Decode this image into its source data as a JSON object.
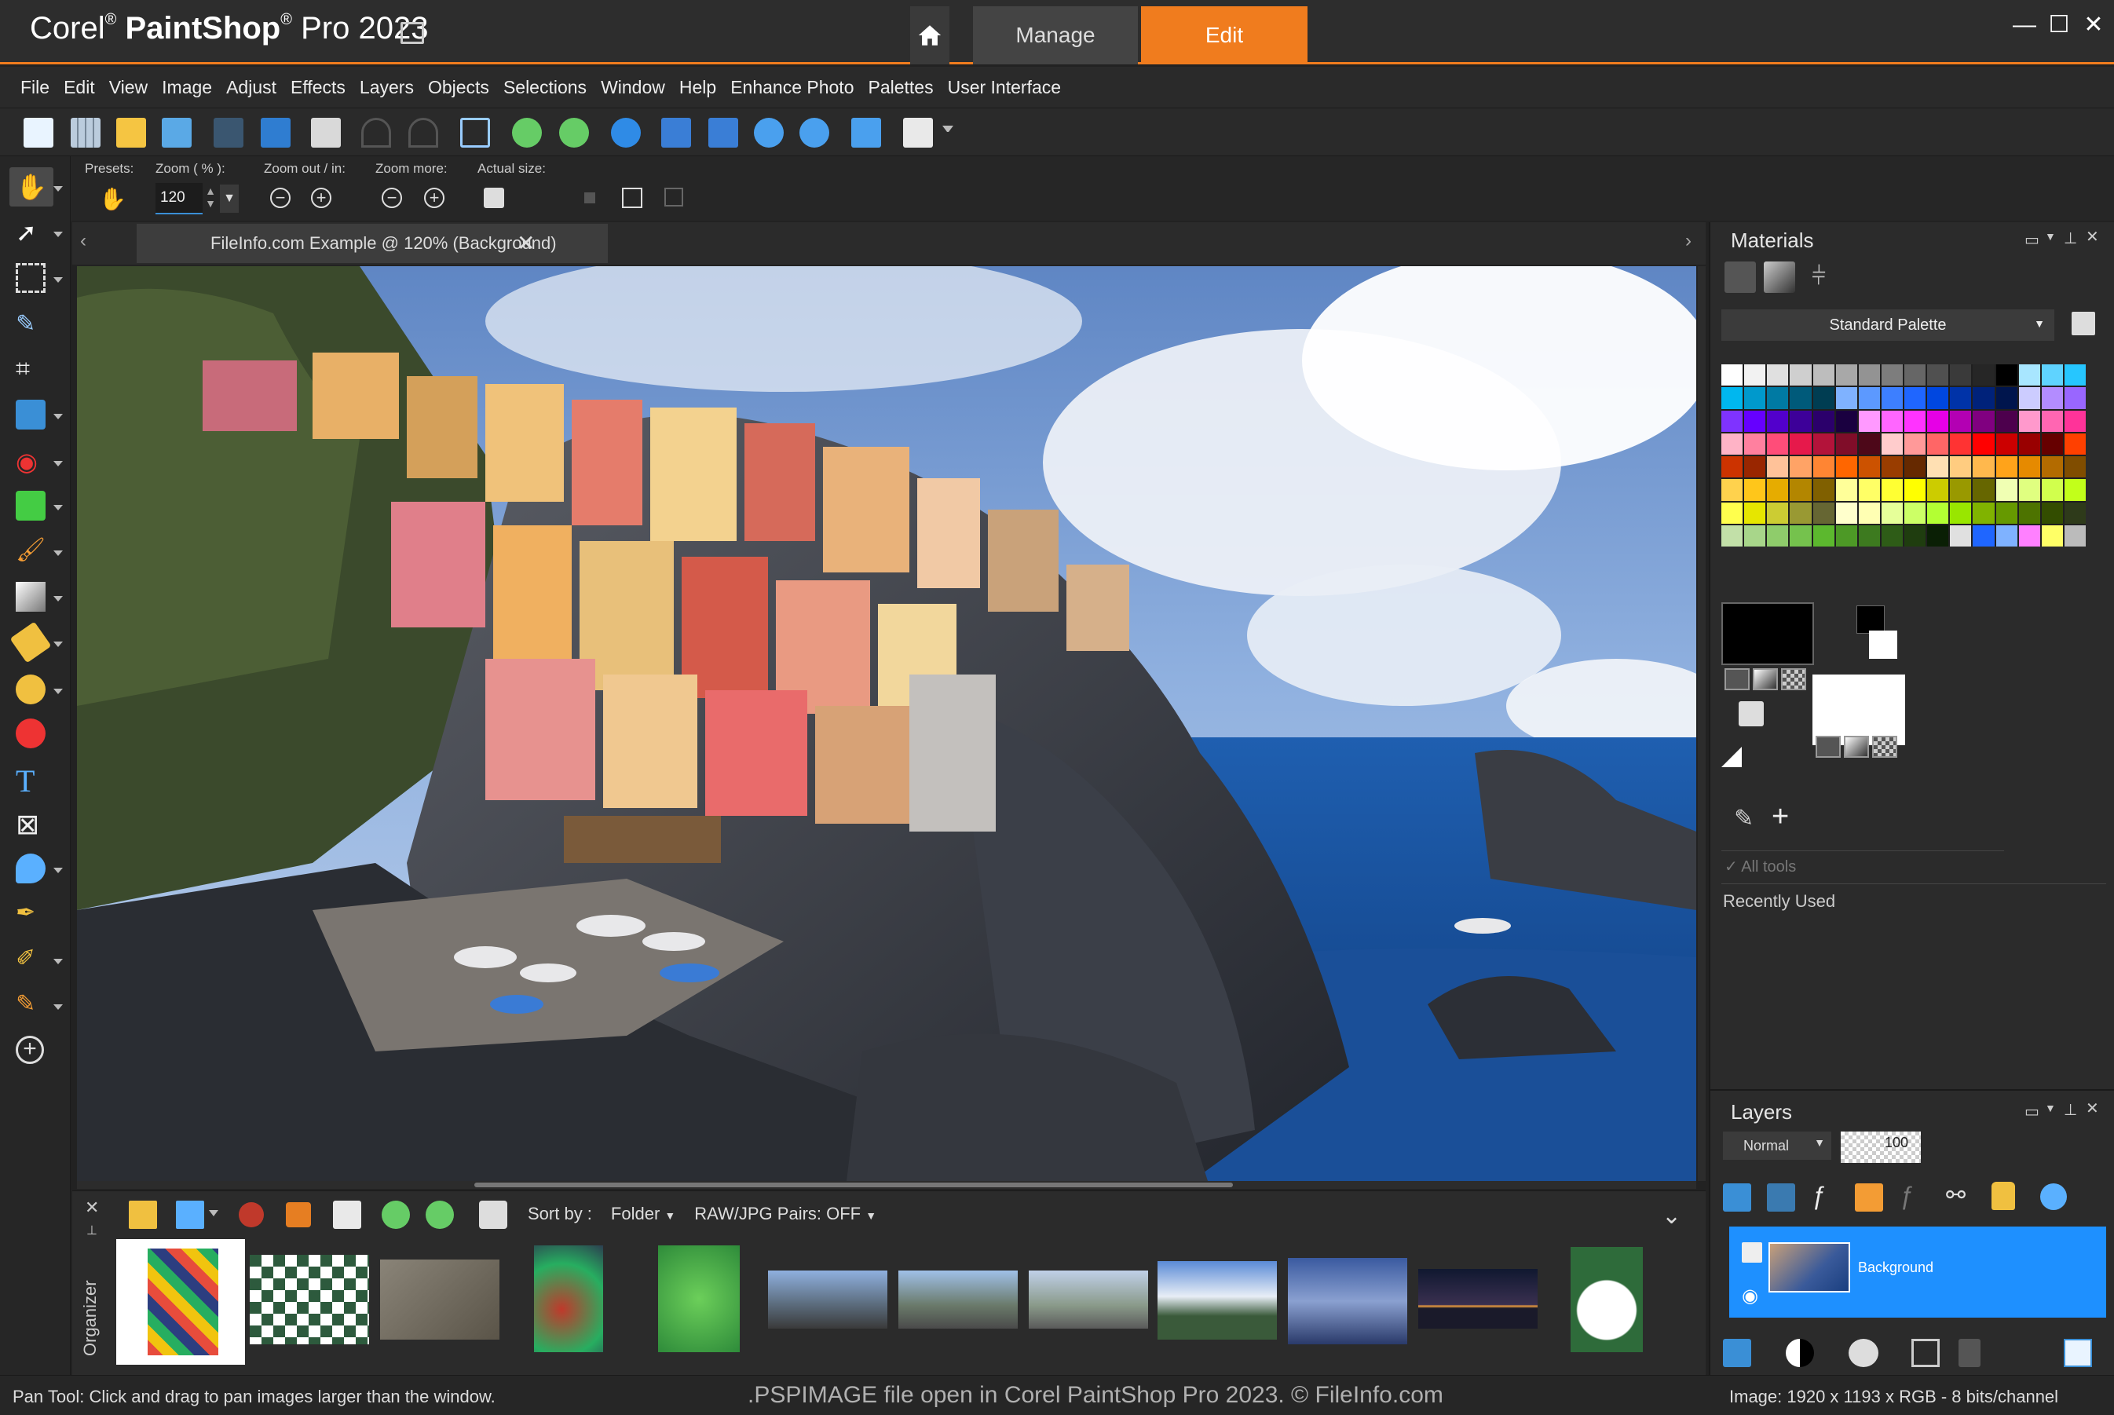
{
  "app": {
    "brand": "Corel",
    "name": "PaintShop",
    "suffix": "Pro 2023"
  },
  "workspace_tabs": {
    "manage": "Manage",
    "edit": "Edit"
  },
  "window_controls": {
    "minimize": "—",
    "maximize": "☐",
    "close": "✕"
  },
  "menu": [
    {
      "label": "File"
    },
    {
      "label": "Edit"
    },
    {
      "label": "View"
    },
    {
      "label": "Image"
    },
    {
      "label": "Adjust"
    },
    {
      "label": "Effects"
    },
    {
      "label": "Layers"
    },
    {
      "label": "Objects"
    },
    {
      "label": "Selections"
    },
    {
      "label": "Window"
    },
    {
      "label": "Help"
    },
    {
      "label": "Enhance Photo"
    },
    {
      "label": "Palettes"
    },
    {
      "label": "User Interface"
    }
  ],
  "options_bar": {
    "presets_label": "Presets:",
    "zoom_label": "Zoom ( % ):",
    "zoom_value": "120",
    "zoom_out_in_label": "Zoom out / in:",
    "zoom_more_label": "Zoom more:",
    "actual_size_label": "Actual size:"
  },
  "document": {
    "tab_label": "FileInfo.com Example @ 120% (Background)"
  },
  "materials": {
    "title": "Materials",
    "palette_name": "Standard Palette",
    "all_tools_label": "All tools",
    "recently_used_label": "Recently Used"
  },
  "layers": {
    "title": "Layers",
    "blend_mode": "Normal",
    "opacity": "100",
    "layer_name": "Background"
  },
  "organizer": {
    "side_label": "Organizer",
    "sort_by_label": "Sort by :",
    "sort_by_value": "Folder",
    "raw_jpg_label": "RAW/JPG Pairs: OFF"
  },
  "status": {
    "tool_hint": "Pan Tool: Click and drag to pan images larger than the window.",
    "watermark": ".PSPIMAGE file open in Corel PaintShop Pro 2023. © FileInfo.com",
    "image_info": "Image:  1920 x 1193 x RGB - 8 bits/channel"
  },
  "colors": {
    "accent": "#f07c1e",
    "selection": "#1e90ff",
    "palette": [
      "#ffffff",
      "#f2f2f2",
      "#e0e0e0",
      "#cfcfcf",
      "#bdbdbd",
      "#a8a8a8",
      "#939393",
      "#7d7d7d",
      "#666666",
      "#505050",
      "#3a3a3a",
      "#262626",
      "#000000",
      "#a8e6ff",
      "#5fd3ff",
      "#26c6ff",
      "#00b7ef",
      "#0099cc",
      "#007aa3",
      "#005a7a",
      "#003d52",
      "#7fb2ff",
      "#5c99ff",
      "#3d7fff",
      "#1f66ff",
      "#0047e0",
      "#0033a8",
      "#00227a",
      "#00154d",
      "#ccccff",
      "#b38cff",
      "#9966ff",
      "#7f33ff",
      "#6600ff",
      "#5200cc",
      "#3d0099",
      "#2b006b",
      "#1a0040",
      "#ff99ff",
      "#ff66ff",
      "#ff33ff",
      "#e600e6",
      "#b300b3",
      "#800080",
      "#4d004d",
      "#ff99cc",
      "#ff66b2",
      "#ff3399",
      "#ffb3c6",
      "#ff809f",
      "#ff4d79",
      "#e6194b",
      "#b3133a",
      "#800d29",
      "#4d0819",
      "#ffcccc",
      "#ff9999",
      "#ff6666",
      "#ff3333",
      "#ff0000",
      "#cc0000",
      "#990000",
      "#660000",
      "#ff4000",
      "#cc3300",
      "#992600",
      "#ffc299",
      "#ffa366",
      "#ff8533",
      "#ff6600",
      "#cc5200",
      "#993d00",
      "#662900",
      "#ffe0b3",
      "#ffcc80",
      "#ffb84d",
      "#ffa31a",
      "#e68a00",
      "#b36b00",
      "#804d00",
      "#ffd24d",
      "#ffc61a",
      "#e6ac00",
      "#b38600",
      "#806000",
      "#ffff99",
      "#ffff66",
      "#ffff33",
      "#ffff00",
      "#cccc00",
      "#999900",
      "#666600",
      "#f0ffb3",
      "#e0ff80",
      "#d1ff4d",
      "#c2ff1a",
      "#ffff4d",
      "#e6e600",
      "#cccc33",
      "#999933",
      "#666633",
      "#ffffcc",
      "#ffffb3",
      "#e6ff99",
      "#ccff66",
      "#b3ff33",
      "#99e600",
      "#80b300",
      "#669900",
      "#4d7300",
      "#334d00",
      "#2e3a1a",
      "#c2e0a8",
      "#a8d68a",
      "#8fcc6b",
      "#75c24d",
      "#5cb82e",
      "#4d9926",
      "#3d7a1f",
      "#2e5c17",
      "#1f3d0f",
      "#0a1f05",
      "#e0e0e0",
      "#1f66ff",
      "#7fb2ff",
      "#ff80ff",
      "#ffff66",
      "#bbbbbb"
    ]
  }
}
